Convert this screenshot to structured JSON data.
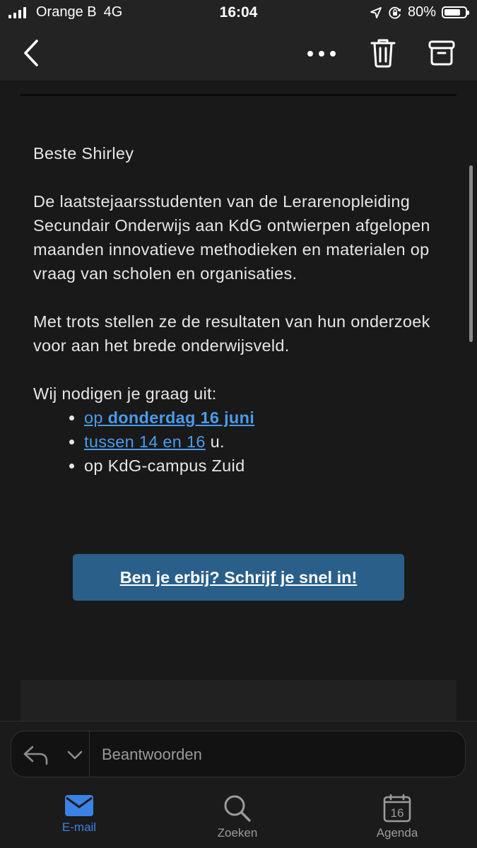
{
  "status_bar": {
    "carrier": "Orange B",
    "network": "4G",
    "time": "16:04",
    "battery_percent": "80%",
    "battery_level": 0.8,
    "icons": [
      "signal-icon",
      "location-icon",
      "orientation-lock-icon",
      "battery-icon"
    ]
  },
  "toolbar": {
    "icons": [
      "back-chevron-icon",
      "more-icon",
      "trash-icon",
      "archive-icon"
    ]
  },
  "email": {
    "greeting": "Beste Shirley",
    "paragraph1": "De laatstejaarsstudenten van de Lerarenopleiding Secundair Onderwijs aan KdG ontwierpen afgelopen maanden innovatieve methodieken en materialen op vraag van scholen en organisaties.",
    "paragraph2": "Met trots stellen ze de resultaten van hun onderzoek voor aan het brede onderwijsveld.",
    "invite_intro": "Wij nodigen je graag uit:",
    "bullets": {
      "b1_prefix": "op",
      "b1_bold": "donderdag 16 juni",
      "b2_link": "tussen 14 en 16",
      "b2_suffix": " u.",
      "b3": "op KdG-campus Zuid"
    },
    "cta_label": "Ben je erbij? Schrijf je snel in!"
  },
  "reply": {
    "placeholder": "Beantwoorden",
    "icons": [
      "reply-icon",
      "chevron-down-icon"
    ]
  },
  "tabs": {
    "mail": "E-mail",
    "search": "Zoeken",
    "agenda": "Agenda",
    "agenda_day": "16",
    "active": "mail"
  },
  "colors": {
    "accent": "#3b82e6",
    "link": "#4a9bea",
    "cta_background": "#2a5f8a",
    "background": "#1b1b1b"
  }
}
